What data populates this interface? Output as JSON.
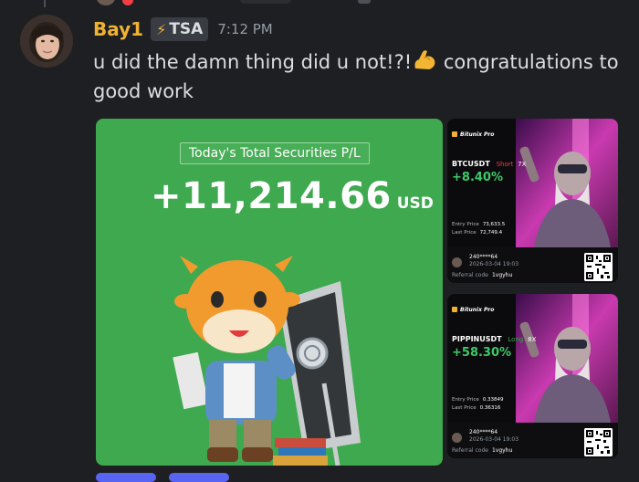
{
  "message": {
    "username": "Bay1",
    "tag": {
      "icon": "lightning-icon",
      "text": "TSA"
    },
    "timestamp": "7:12 PM",
    "text_part1": "u did the damn thing did u not!?!",
    "emoji": "flexed-biceps-emoji",
    "text_part2": " congratulations to good work",
    "colors": {
      "username": "#f0b232",
      "background": "#1e1f22"
    }
  },
  "main_card": {
    "label": "Today's Total Securities P/L",
    "amount": "+11,214.66",
    "currency": "USD",
    "background": "#3ea94e"
  },
  "side_cards": [
    {
      "brand": "Bitunix Pro",
      "pair": "BTCUSDT",
      "direction": "Short",
      "leverage": "7X",
      "pnl_percent": "+8.40%",
      "entry_label": "Entry Price",
      "entry_price": "73,633.5",
      "last_label": "Last Price",
      "last_price": "72,749.4",
      "user_id": "240****64",
      "datetime": "2026-03-04 19:03",
      "referral_label": "Referral code",
      "referral_code": "1vgyhu"
    },
    {
      "brand": "Bitunix Pro",
      "pair": "PIPPINUSDT",
      "direction": "Long",
      "leverage": "8X",
      "pnl_percent": "+58.30%",
      "entry_label": "Entry Price",
      "entry_price": "0.33849",
      "last_label": "Last Price",
      "last_price": "0.36316",
      "user_id": "240****64",
      "datetime": "2026-03-04 19:03",
      "referral_label": "Referral code",
      "referral_code": "1vgyhu"
    }
  ]
}
